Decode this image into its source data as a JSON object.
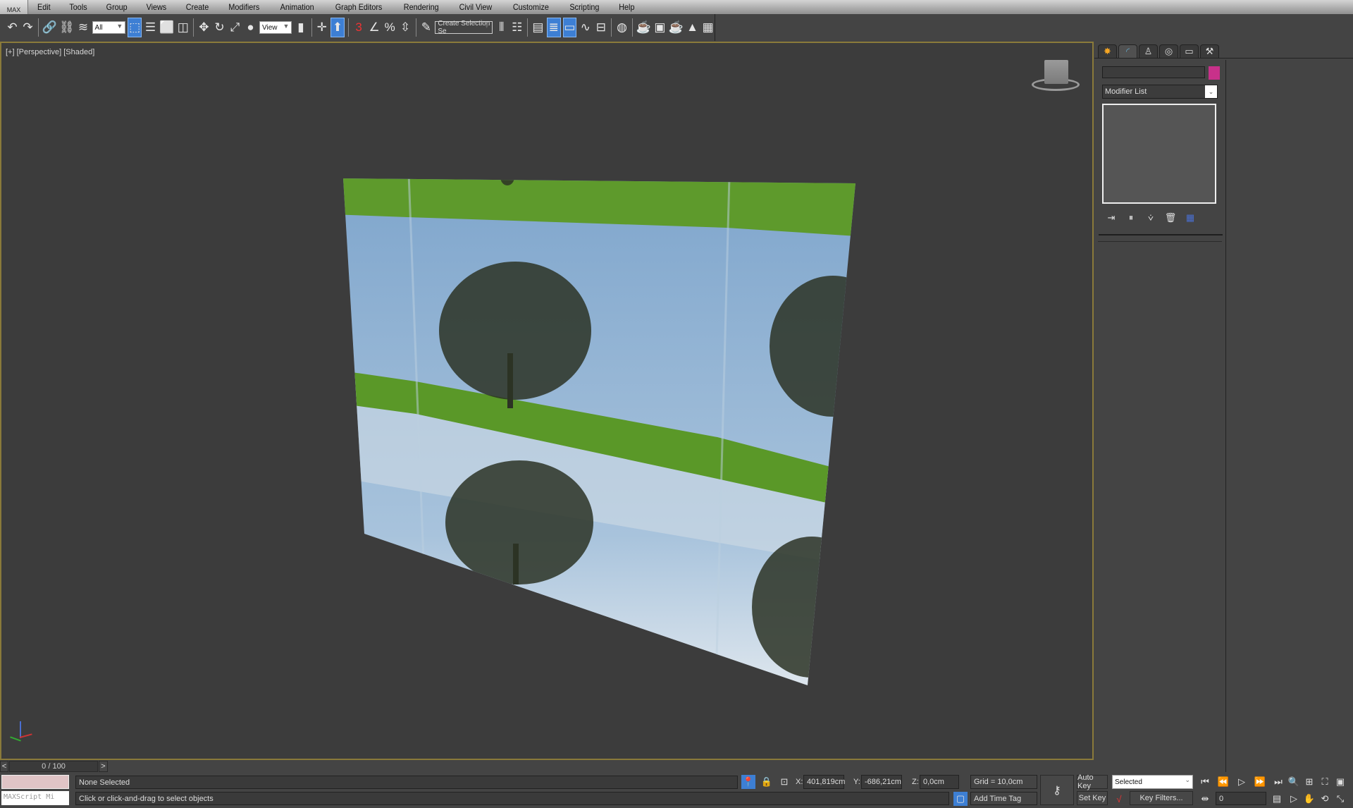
{
  "app": {
    "logo": "MAX"
  },
  "menu": [
    "Edit",
    "Tools",
    "Group",
    "Views",
    "Create",
    "Modifiers",
    "Animation",
    "Graph Editors",
    "Rendering",
    "Civil View",
    "Customize",
    "Scripting",
    "Help"
  ],
  "toolbar": {
    "selection_filter": "All",
    "ref_coord": "View",
    "named_selection_placeholder": "Create Selection Se",
    "icons": [
      "undo-icon",
      "redo-icon",
      "link-icon",
      "unlink-icon",
      "bind-space-warp-icon"
    ],
    "select_icons": [
      "select-object-icon",
      "select-by-name-icon",
      "rectangular-region-icon",
      "window-crossing-icon"
    ],
    "transform_icons": [
      "move-icon",
      "rotate-icon",
      "scale-icon"
    ],
    "right_icons": [
      "mirror-icon",
      "align-icon",
      "layer-explorer-icon",
      "scene-explorer-icon",
      "curve-editor-icon",
      "schematic-view-icon",
      "material-editor-icon",
      "render-setup-icon",
      "rendered-frame-window-icon",
      "render-icon",
      "render-iterative-icon",
      "render-in-cloud-icon"
    ]
  },
  "viewport": {
    "label": "[+] [Perspective] [Shaded]",
    "viewcube": "view-cube"
  },
  "command_panel": {
    "tabs": [
      "create-tab",
      "modify-tab",
      "hierarchy-tab",
      "motion-tab",
      "display-tab",
      "utilities-tab"
    ],
    "name_value": "",
    "object_color": "#c8318a",
    "modifier_list": "Modifier List",
    "stack_icons": [
      "pin-stack-icon",
      "show-end-result-icon",
      "make-unique-icon",
      "remove-modifier-icon",
      "configure-sets-icon"
    ]
  },
  "timeline": {
    "frame_label": "0 / 100",
    "prev": "<",
    "next": ">"
  },
  "status": {
    "maxscript_placeholder": "MAXScript Mi",
    "selection": "None Selected",
    "prompt": "Click or click-and-drag to select objects",
    "x_label": "X:",
    "x": "401,819cm",
    "y_label": "Y:",
    "y": "-686,21cm",
    "z_label": "Z:",
    "z": "0,0cm",
    "grid": "Grid = 10,0cm",
    "add_time_tag": "Add Time Tag",
    "auto_key": "Auto Key",
    "set_key": "Set Key",
    "key_mode": "Selected",
    "key_filters": "Key Filters...",
    "current_frame": "0"
  },
  "colors": {
    "accent": "#3d7fd4",
    "viewport_border": "#8a7a3a",
    "sky": "#86acd0",
    "grass": "#5e9a2c"
  }
}
